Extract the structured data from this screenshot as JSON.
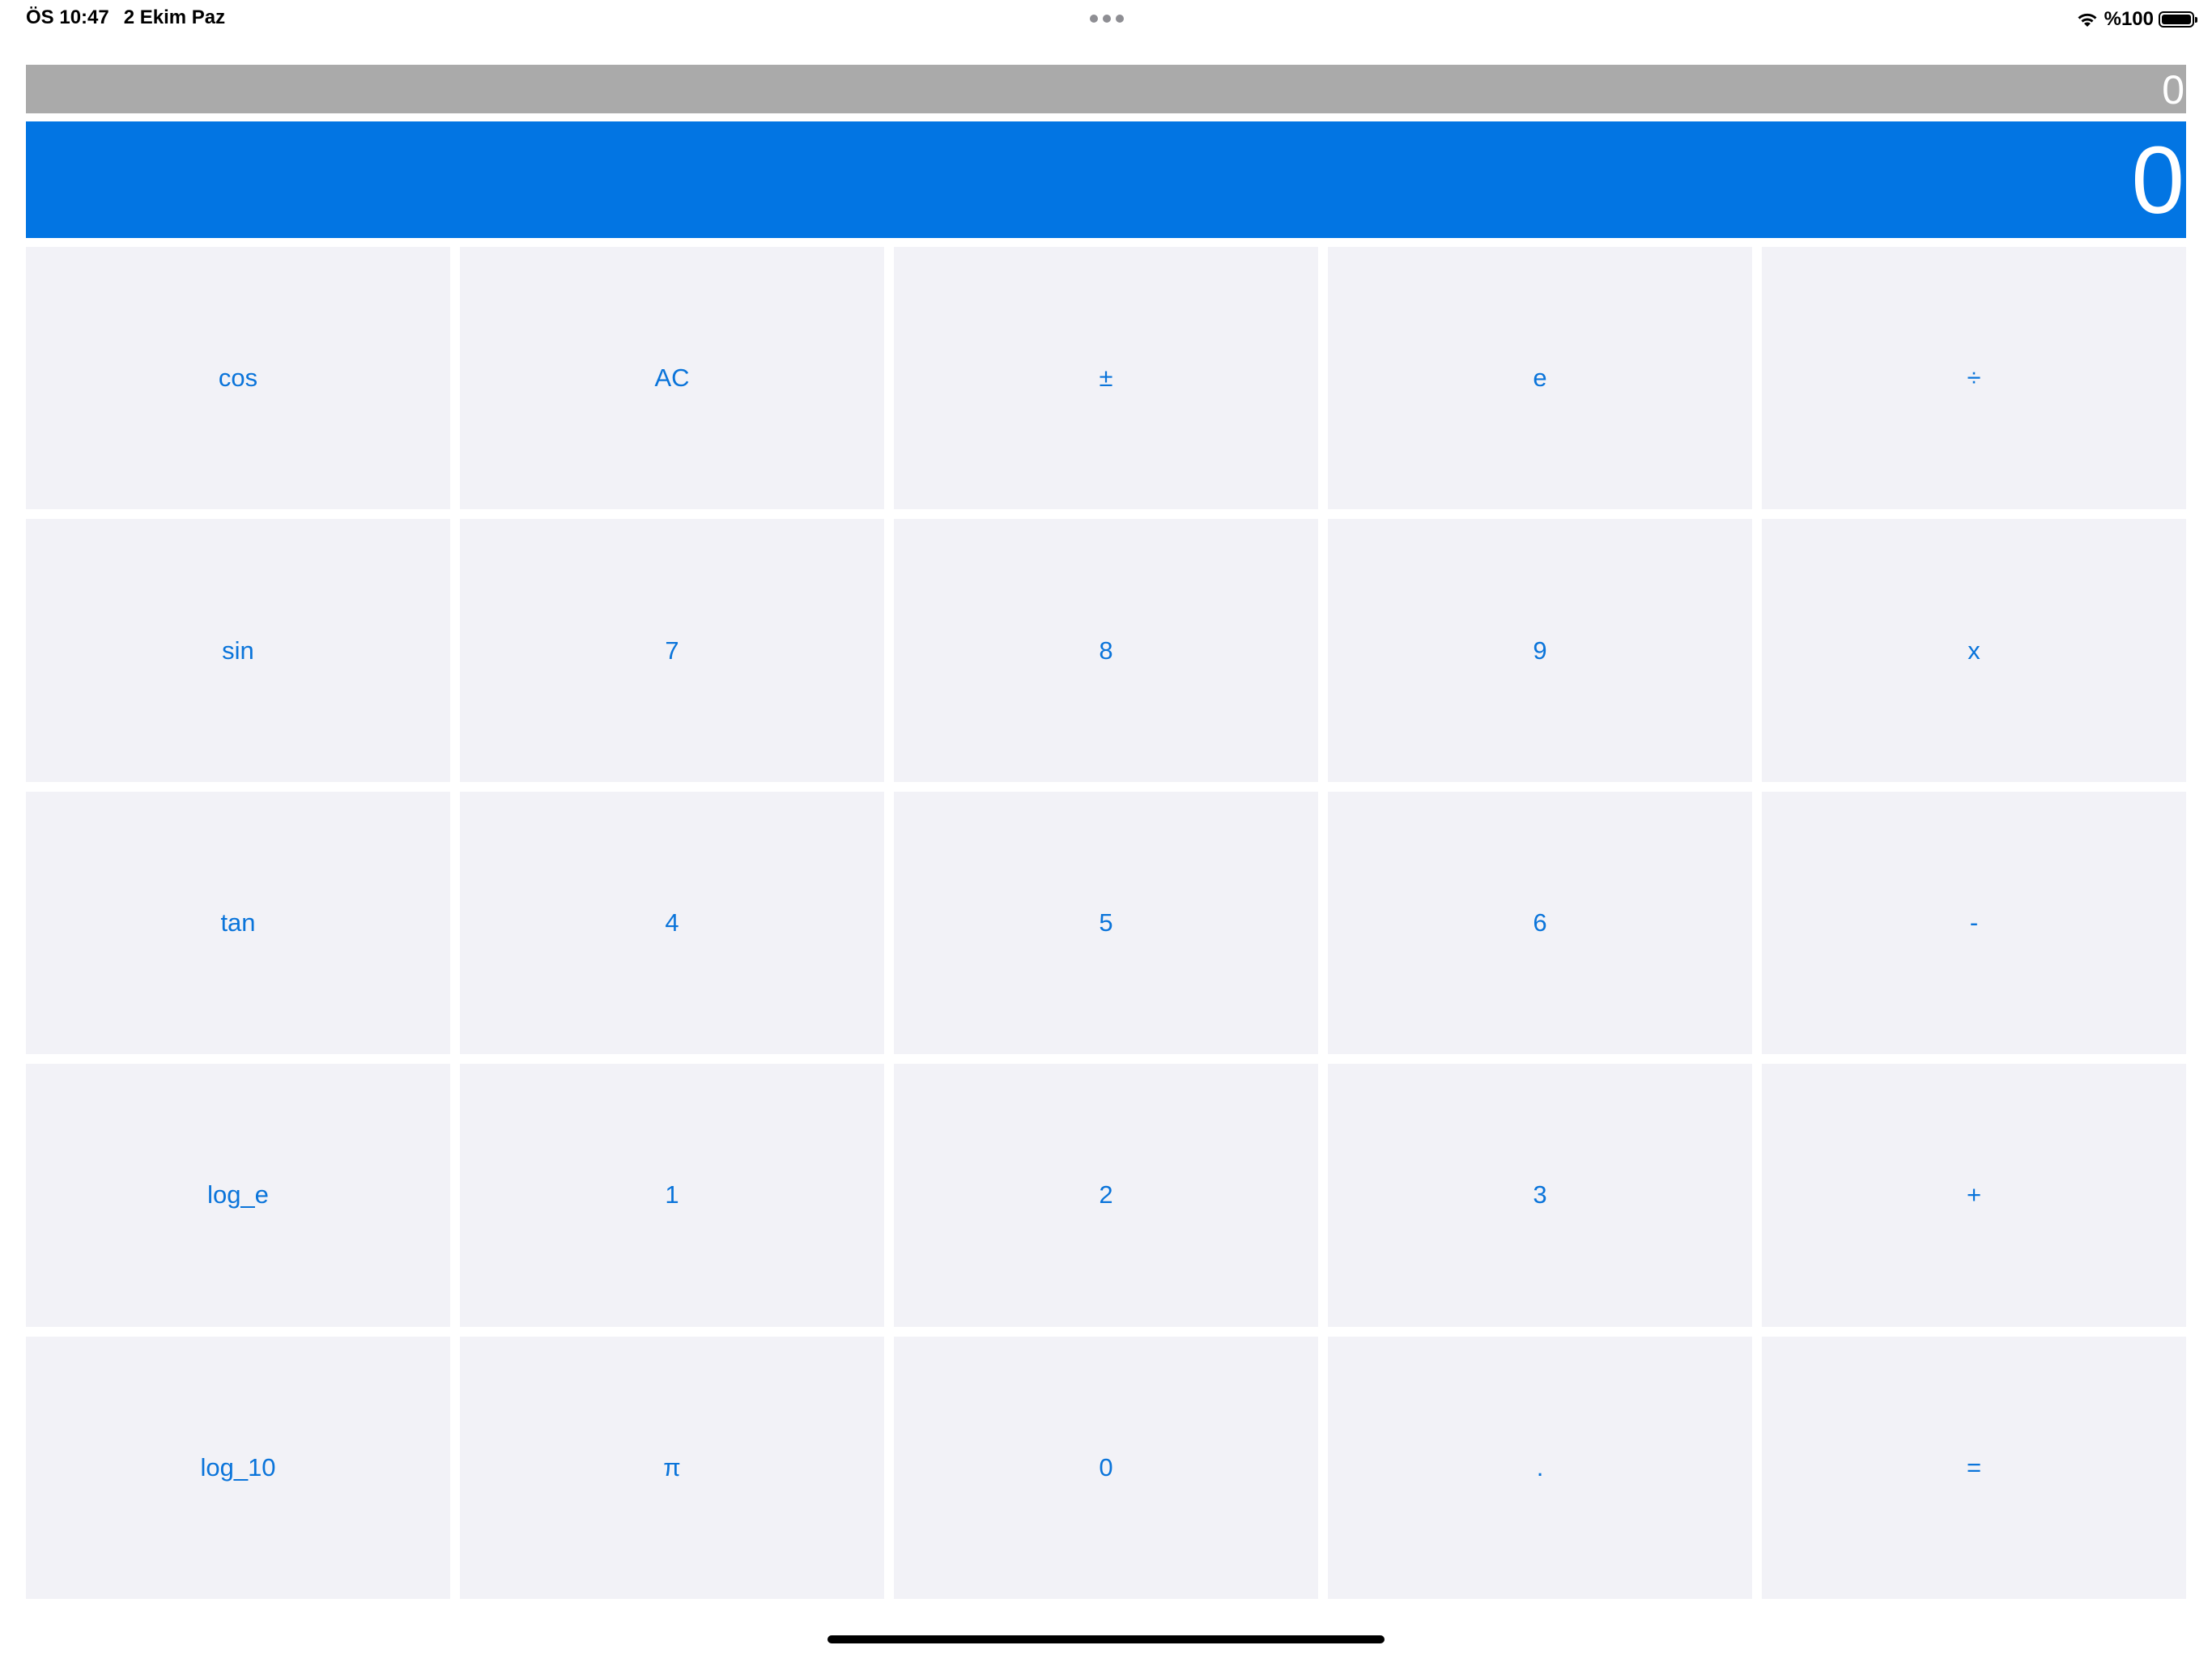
{
  "status_bar": {
    "time": "ÖS 10:47",
    "date": "2 Ekim Paz",
    "battery_text": "%100",
    "icons": [
      "wifi-icon",
      "battery-icon",
      "multitask-dots-icon"
    ]
  },
  "display": {
    "secondary_value": "0",
    "main_value": "0"
  },
  "colors": {
    "display_main_bg": "#0275e3",
    "display_secondary_bg": "#aaaaaa",
    "key_bg": "#f2f2f7",
    "key_text": "#0a74da"
  },
  "keypad": {
    "rows": [
      [
        "cos",
        "AC",
        "±",
        "e",
        "÷"
      ],
      [
        "sin",
        "7",
        "8",
        "9",
        "x"
      ],
      [
        "tan",
        "4",
        "5",
        "6",
        "-"
      ],
      [
        "log_e",
        "1",
        "2",
        "3",
        "+"
      ],
      [
        "log_10",
        "π",
        "0",
        ".",
        "="
      ]
    ]
  }
}
